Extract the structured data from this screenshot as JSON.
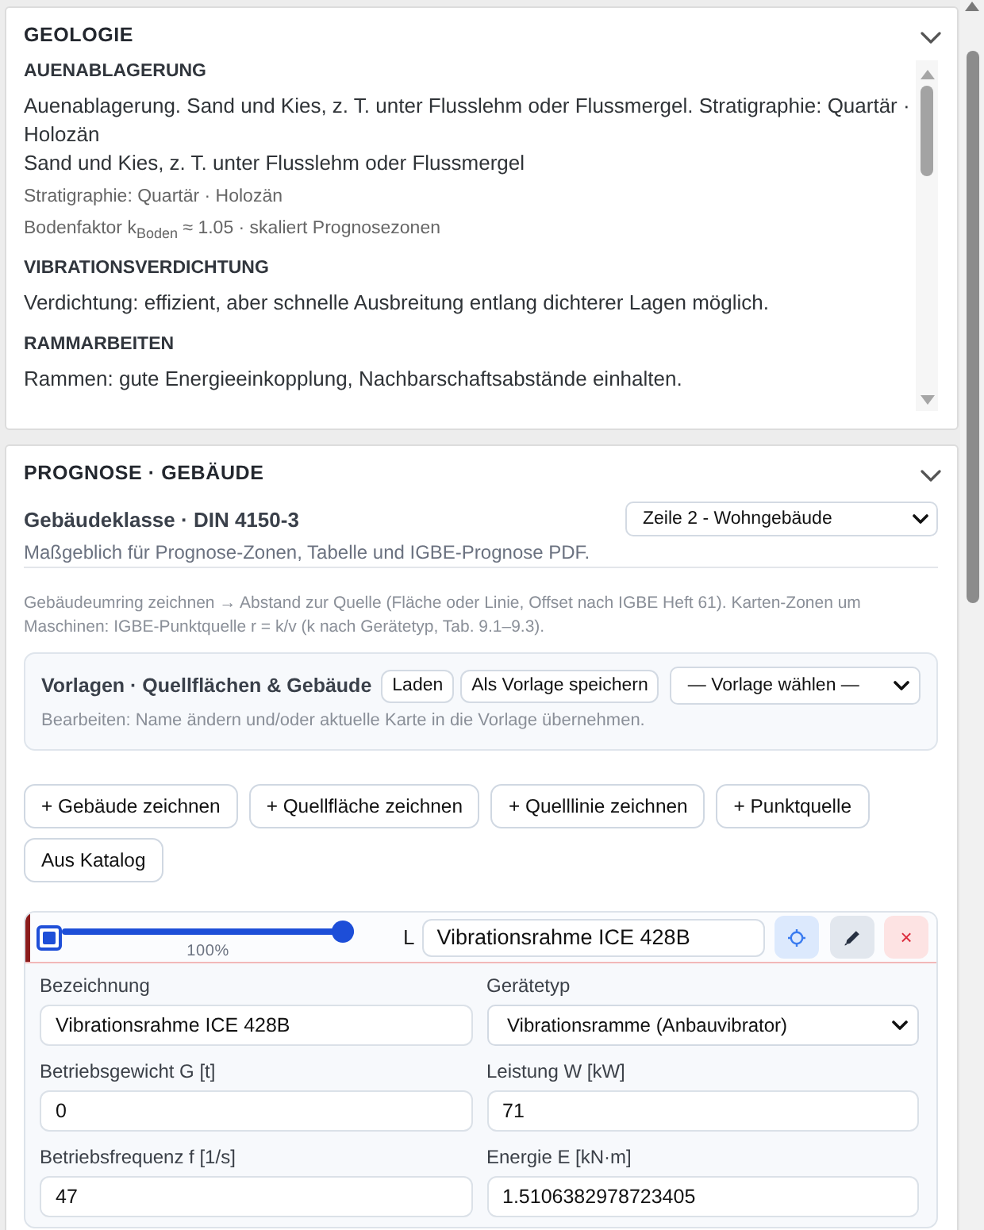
{
  "geology": {
    "title": "GEOLOGIE",
    "sections": [
      {
        "heading": "AUENABLAGERUNG",
        "lines": [
          {
            "kind": "text",
            "text": "Auenablagerung. Sand und Kies, z. T. unter Flusslehm oder Flussmergel. Stratigraphie: Quartär · Holozän"
          },
          {
            "kind": "text",
            "text": "Sand und Kies, z. T. unter Flusslehm oder Flussmergel"
          },
          {
            "kind": "note",
            "text": "Stratigraphie: Quartär · Holozän"
          },
          {
            "kind": "note",
            "text": "Bodenfaktor k$_{Boden}$ ≈ 1.05 · skaliert Prognosezonen"
          }
        ]
      },
      {
        "heading": "VIBRATIONSVERDICHTUNG",
        "lines": [
          {
            "kind": "text",
            "text": "Verdichtung: effizient, aber schnelle Ausbreitung entlang dichterer Lagen möglich."
          }
        ]
      },
      {
        "heading": "RAMMARBEITEN",
        "lines": [
          {
            "kind": "text",
            "text": "Rammen: gute Energieeinkopplung, Nachbarschaftsabstände einhalten."
          }
        ]
      }
    ]
  },
  "prognosis": {
    "title": "PROGNOSE · GEBÄUDE",
    "building_class": {
      "label": "Gebäudeklasse · DIN 4150‑3",
      "value": "Zeile 2 - Wohngebäude",
      "hint": "Maßgeblich für Prognose‑Zonen, Tabelle und IGBE‑Prognose PDF."
    },
    "note": "Gebäudeumring zeichnen → Abstand zur Quelle (Fläche oder Linie, Offset nach IGBE Heft 61). Karten‑Zonen um Maschinen: IGBE‑Punktquelle r = k/v (k nach Gerätetyp, Tab. 9.1–9.3).",
    "templates": {
      "title": "Vorlagen · Quellflächen & Gebäude",
      "buttons": [
        "Laden",
        "Als Vorlage speichern"
      ],
      "select": "— Vorlage wählen —",
      "hint": "Bearbeiten: Name ändern und/oder aktuelle Karte in die Vorlage übernehmen."
    },
    "actions": [
      "+ Gebäude zeichnen",
      "+ Quellfläche zeichnen",
      "+ Quelllinie zeichnen",
      "+ Punktquelle",
      "Aus Katalog"
    ],
    "sources": [
      {
        "color": "#8b1c1c",
        "checked": true,
        "level": 1,
        "reading": "100%",
        "tag": "L",
        "name": "Vibrationsrahme ICE 428B",
        "delete_label": "×",
        "fields": [
          {
            "kind": "input",
            "label": "Bezeichnung",
            "value": "Vibrationsrahme ICE 428B"
          },
          {
            "kind": "select",
            "label": "Gerätetyp",
            "value": "Vibrationsramme (Anbauvibrator)"
          },
          {
            "kind": "input",
            "label": "Betriebsgewicht G [t]",
            "value": "0"
          },
          {
            "kind": "input",
            "label": "Leistung W [kW]",
            "value": "71"
          },
          {
            "kind": "input",
            "label": "Betriebsfrequenz f [1/s]",
            "value": "47"
          },
          {
            "kind": "input",
            "label": "Energie E [kN·m]",
            "value": "1.5106382978723405"
          }
        ]
      }
    ]
  }
}
